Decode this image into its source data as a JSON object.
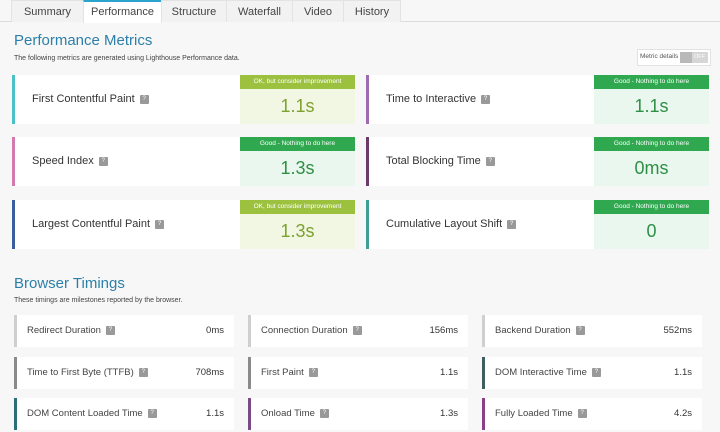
{
  "tabs": [
    {
      "label": "Summary"
    },
    {
      "label": "Performance"
    },
    {
      "label": "Structure"
    },
    {
      "label": "Waterfall"
    },
    {
      "label": "Video"
    },
    {
      "label": "History"
    }
  ],
  "active_tab": "Performance",
  "performance": {
    "title": "Performance Metrics",
    "description": "The following metrics are generated using Lighthouse Performance data.",
    "toggle_label": "Metric details",
    "toggle_state": "OFF",
    "metrics": [
      {
        "name": "First Contentful Paint",
        "badge": "OK, but consider improvement",
        "value": "1.1s",
        "status": "ok",
        "accent": "#4bc0c8"
      },
      {
        "name": "Time to Interactive",
        "badge": "Good - Nothing to do here",
        "value": "1.1s",
        "status": "good",
        "accent": "#9e6bb0"
      },
      {
        "name": "Speed Index",
        "badge": "Good - Nothing to do here",
        "value": "1.3s",
        "status": "good",
        "accent": "#d17bb0"
      },
      {
        "name": "Total Blocking Time",
        "badge": "Good - Nothing to do here",
        "value": "0ms",
        "status": "good",
        "accent": "#6b3a6b"
      },
      {
        "name": "Largest Contentful Paint",
        "badge": "OK, but consider improvement",
        "value": "1.3s",
        "status": "ok",
        "accent": "#3a5f9c"
      },
      {
        "name": "Cumulative Layout Shift",
        "badge": "Good - Nothing to do here",
        "value": "0",
        "status": "good",
        "accent": "#3c9e94"
      }
    ]
  },
  "timings": {
    "title": "Browser Timings",
    "description": "These timings are milestones reported by the browser.",
    "items": [
      {
        "name": "Redirect Duration",
        "value": "0ms",
        "accent": "#cfcfcf"
      },
      {
        "name": "Connection Duration",
        "value": "156ms",
        "accent": "#cfcfcf"
      },
      {
        "name": "Backend Duration",
        "value": "552ms",
        "accent": "#cfcfcf"
      },
      {
        "name": "Time to First Byte (TTFB)",
        "value": "708ms",
        "accent": "#8a8a8a"
      },
      {
        "name": "First Paint",
        "value": "1.1s",
        "accent": "#8a8a8a"
      },
      {
        "name": "DOM Interactive Time",
        "value": "1.1s",
        "accent": "#3f5f5f"
      },
      {
        "name": "DOM Content Loaded Time",
        "value": "1.1s",
        "accent": "#2e6e78"
      },
      {
        "name": "Onload Time",
        "value": "1.3s",
        "accent": "#7a4a86"
      },
      {
        "name": "Fully Loaded Time",
        "value": "4.2s",
        "accent": "#8a3f86"
      }
    ]
  },
  "colors": {
    "ok_badge": "#9bc13f",
    "ok_value_bg": "#f1f7e3",
    "ok_value_text": "#7ea12e",
    "good_badge": "#2fa84f",
    "good_value_bg": "#eaf7ee",
    "good_value_text": "#2f8f46",
    "title": "#2c7fa8"
  }
}
